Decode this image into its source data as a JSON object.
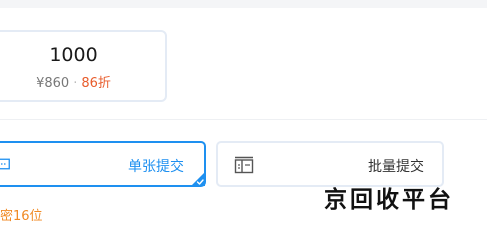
{
  "price_option": {
    "amount": "1000",
    "price": "¥860",
    "separator": "·",
    "discount": "86折"
  },
  "submit_modes": {
    "single": {
      "label": "单张提交",
      "icon": "single-card-icon",
      "selected": true
    },
    "batch": {
      "label": "批量提交",
      "icon": "batch-list-icon",
      "selected": false
    }
  },
  "note": "密16位",
  "watermark": "京回收平台",
  "colors": {
    "accent": "#1e90f0",
    "discount": "#e85c2c",
    "note": "#f08a24",
    "card_border": "#e4ebf5"
  }
}
